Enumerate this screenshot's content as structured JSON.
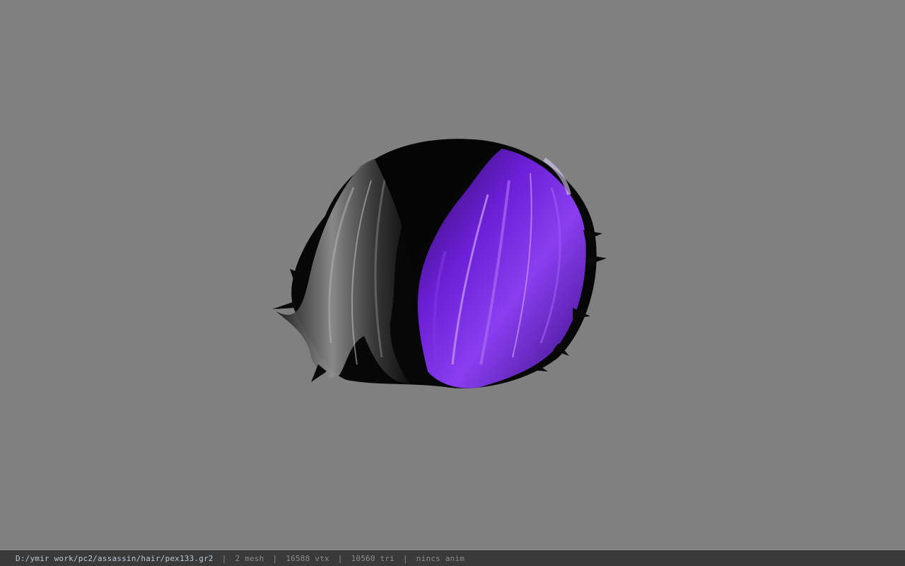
{
  "viewer": {
    "background_color": "#808080",
    "model": {
      "icon": "hair-model",
      "colors": {
        "dark": "#0a0a0a",
        "gray": "#9a9a9a",
        "purple": "#6b1fd6",
        "purple_highlight": "#c79af2"
      }
    }
  },
  "statusbar": {
    "path": "D:/ymir work/pc2/assassin/hair/pex133.gr2",
    "separator": "|",
    "mesh": "2 mesh",
    "vtx": "16588 vtx",
    "tri": "10560 tri",
    "anim": "nincs anim"
  }
}
